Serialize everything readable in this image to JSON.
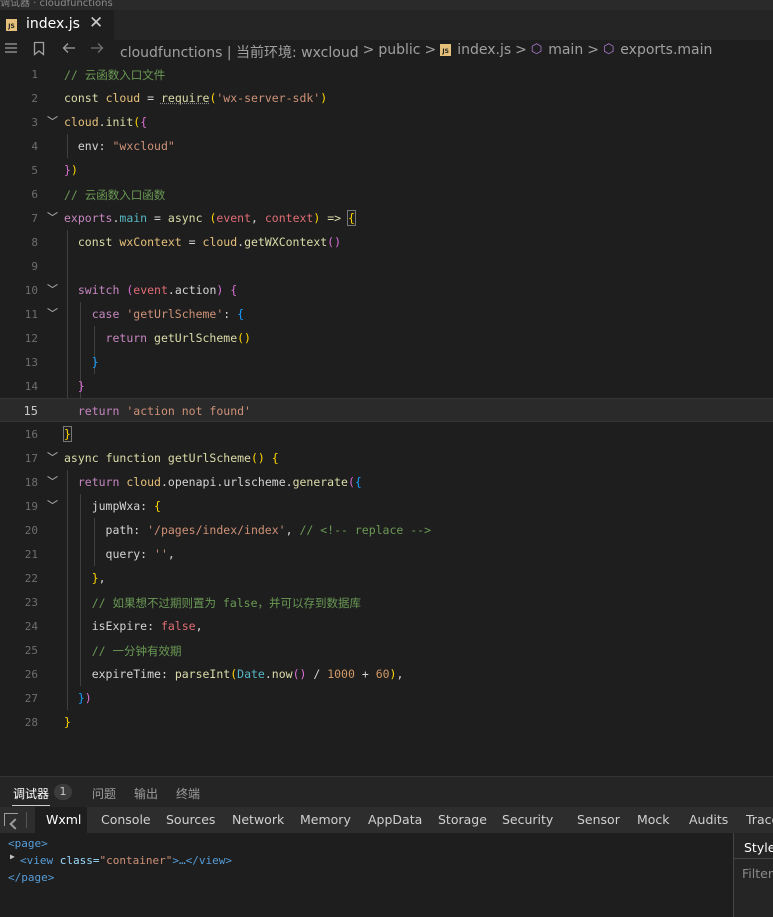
{
  "title_strip": "调试器 · cloudfunctions",
  "tab": {
    "badge": "JS",
    "label": "index.js",
    "close": "✕"
  },
  "breadcrumb": {
    "segment1": "cloudfunctions | 当前环境: wxcloud",
    "segment2": "public",
    "segment3": "index.js",
    "segment4": "main",
    "segment5": "exports.main",
    "separator": ">"
  },
  "editor": {
    "line_numbers": [
      "1",
      "2",
      "3",
      "4",
      "5",
      "6",
      "7",
      "8",
      "9",
      "10",
      "11",
      "12",
      "13",
      "14",
      "15",
      "16",
      "17",
      "18",
      "19",
      "20",
      "21",
      "22",
      "23",
      "24",
      "25",
      "26",
      "27",
      "28"
    ],
    "active_line": 15,
    "c1": "// 云函数入口文件",
    "c6": "// 云函数入口函数",
    "c23": "// 如果想不过期则置为 false，并可以存到数据库",
    "c25": "// 一分钟有效期",
    "s_sdk": "'wx-server-sdk'",
    "s_env": "\"wxcloud\"",
    "s_case": "'getUrlScheme'",
    "s_notfound": "'action not found'",
    "s_path": "'/pages/index/index'",
    "c_replace": "// <!-- replace -->",
    "s_empty": "''"
  },
  "panel": {
    "tabs": [
      "调试器",
      "问题",
      "输出",
      "终端"
    ],
    "badge_count": "1",
    "devtools_tabs": [
      "Wxml",
      "Console",
      "Sources",
      "Network",
      "Memory",
      "AppData",
      "Storage",
      "Security",
      "Sensor",
      "Mock",
      "Audits",
      "Trace"
    ],
    "dom": {
      "open_page": "<page>",
      "view_open": "<view",
      "view_attr": " class=",
      "view_val": "\"container\"",
      "view_rest": ">…</view>",
      "close_page": "</page>"
    },
    "styles_tab": "Styles",
    "filter": "Filter"
  }
}
